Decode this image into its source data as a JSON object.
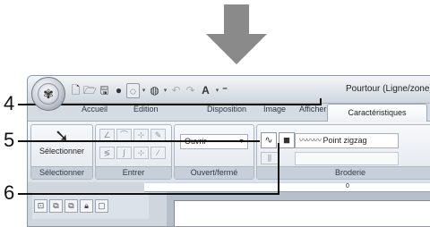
{
  "title": "Pourtour (Ligne/zone)",
  "quick_access": {
    "dropdown_glyph": "▾",
    "font_button": "A"
  },
  "tabs": [
    {
      "label": "Accueil"
    },
    {
      "label": "Edition"
    },
    {
      "label": "Disposition"
    },
    {
      "label": "Image"
    },
    {
      "label": "Afficher"
    }
  ],
  "active_tab": "Caractéristiques",
  "groups": {
    "select": {
      "button_label": "Sélectionner",
      "label": "Sélectionner"
    },
    "input": {
      "label": "Entrer"
    },
    "openclose": {
      "combo_value": "Ouvrir",
      "label": "Ouvert/fermé"
    },
    "embroidery": {
      "stitch_value": "Point zigzag",
      "stitch_preview": "〰〰〰",
      "label": "Broderie"
    }
  },
  "ruler": {
    "tick_label": "0"
  },
  "callouts": [
    {
      "number": "4"
    },
    {
      "number": "5"
    },
    {
      "number": "6"
    }
  ]
}
